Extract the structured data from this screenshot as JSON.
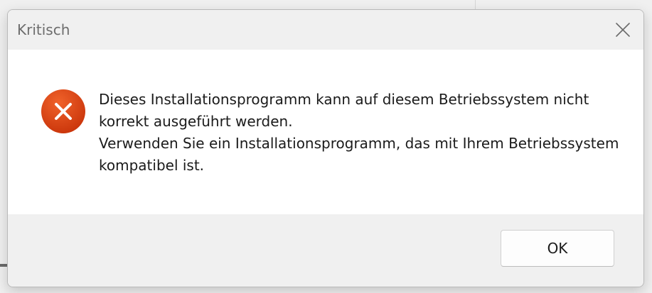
{
  "dialog": {
    "title": "Kritisch",
    "close_icon": "close-icon",
    "status_icon": "error-icon",
    "accent_color": "#d83b01",
    "message_lines": [
      "Dieses Installationsprogramm kann auf diesem Betriebssystem nicht korrekt ausgeführt werden.",
      "Verwenden Sie ein Installationsprogramm, das mit Ihrem Betriebssystem kompatibel ist."
    ],
    "ok_label": "OK"
  }
}
